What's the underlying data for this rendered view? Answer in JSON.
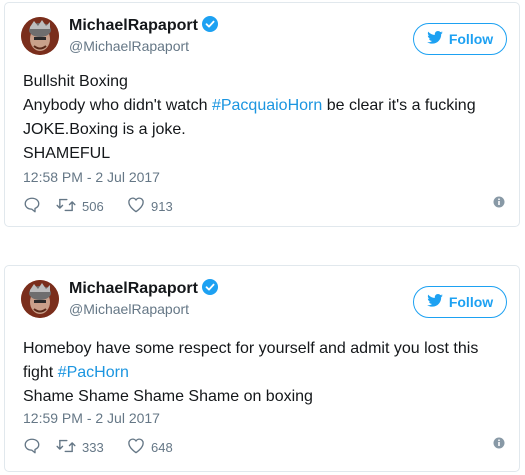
{
  "tweets": [
    {
      "name": "MichaelRapaport",
      "handle": "@MichaelRapaport",
      "follow_label": "Follow",
      "lines": [
        "Bullshit Boxing",
        {
          "before": "Anybody who didn't watch ",
          "hashtag": "#PacquaioHorn",
          "after": " be clear it's a fucking"
        },
        "JOKE.Boxing is a joke.",
        "SHAMEFUL"
      ],
      "timestamp": "12:58 PM - 2 Jul 2017",
      "retweets": "506",
      "likes": "913"
    },
    {
      "name": "MichaelRapaport",
      "handle": "@MichaelRapaport",
      "follow_label": "Follow",
      "lines": [
        "Homeboy have some respect for yourself and admit you lost this",
        {
          "before": "fight ",
          "hashtag": "#PacHorn",
          "after": ""
        },
        "Shame Shame Shame Shame on boxing"
      ],
      "timestamp": "12:59 PM - 2 Jul 2017",
      "retweets": "333",
      "likes": "648"
    }
  ],
  "colors": {
    "accent": "#1da1f2",
    "hashtag": "#1b95e0",
    "muted": "#657786",
    "border": "#e1e8ed"
  },
  "icons": [
    "verified-badge-icon",
    "twitter-bird-icon",
    "reply-icon",
    "retweet-icon",
    "heart-icon",
    "info-icon"
  ]
}
